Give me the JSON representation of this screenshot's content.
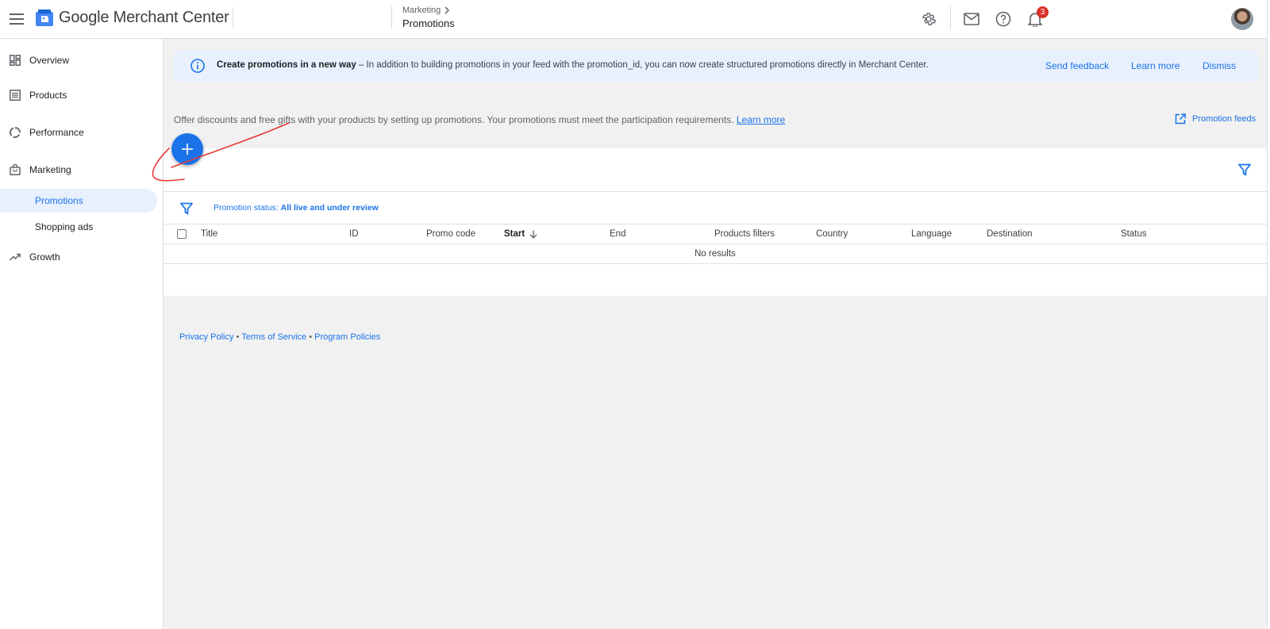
{
  "header": {
    "app_title": "Google Merchant Center",
    "breadcrumb_parent": "Marketing",
    "page_title": "Promotions",
    "notification_count": "3"
  },
  "sidebar": {
    "items": [
      {
        "label": "Overview",
        "icon": "dashboard-icon"
      },
      {
        "label": "Products",
        "icon": "list-icon"
      },
      {
        "label": "Performance",
        "icon": "donut-chart-icon"
      },
      {
        "label": "Marketing",
        "icon": "shopping-bag-icon"
      },
      {
        "label": "Promotions",
        "active": true
      },
      {
        "label": "Shopping ads"
      },
      {
        "label": "Growth",
        "icon": "trending-up-icon"
      }
    ]
  },
  "banner": {
    "title": "Create promotions in a new way",
    "text": " – In addition to building promotions in your feed with the promotion_id, you can now create structured promotions directly in Merchant Center.",
    "send_feedback": "Send feedback",
    "learn_more": "Learn more",
    "dismiss": "Dismiss"
  },
  "intro": {
    "text": "Offer discounts and free gifts with your products by setting up promotions. Your promotions must meet the participation requirements. ",
    "learn_more": "Learn more",
    "promotion_feeds": "Promotion feeds"
  },
  "filter": {
    "label": "Promotion status: ",
    "value": "All live and under review"
  },
  "table": {
    "columns": [
      "Title",
      "ID",
      "Promo code",
      "Start",
      "End",
      "Products filters",
      "Country",
      "Language",
      "Destination",
      "Status"
    ],
    "sorted_column": "Start",
    "sort_direction": "descending",
    "empty_text": "No results"
  },
  "footer": {
    "privacy": "Privacy Policy",
    "terms": "Terms of Service",
    "policies": "Program Policies",
    "separator": " • "
  },
  "colors": {
    "accent": "#1a73e8",
    "banner_bg": "#e8f0fe",
    "badge": "#d93025",
    "annotation": "#e53935"
  }
}
